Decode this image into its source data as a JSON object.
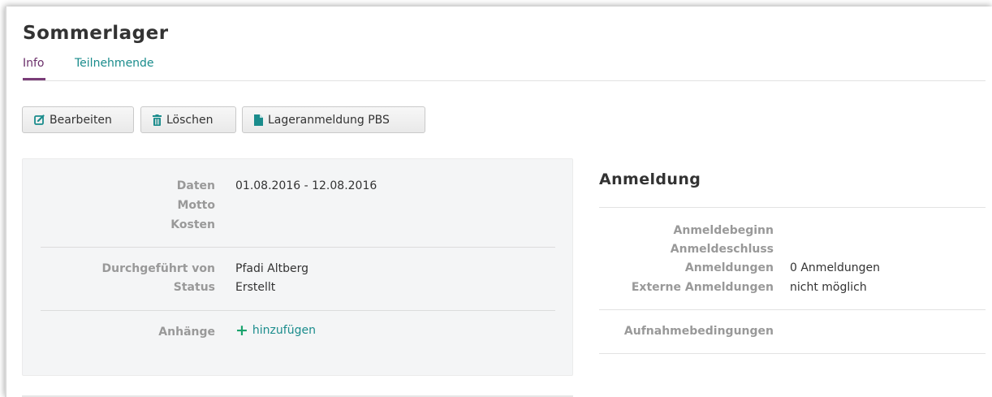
{
  "page": {
    "title": "Sommerlager"
  },
  "tabs": [
    {
      "label": "Info",
      "active": true
    },
    {
      "label": "Teilnehmende",
      "active": false
    }
  ],
  "toolbar": {
    "edit_label": "Bearbeiten",
    "delete_label": "Löschen",
    "pbs_label": "Lageranmeldung PBS",
    "edit_icon": "edit-icon",
    "delete_icon": "trash-icon",
    "pbs_icon": "file-icon"
  },
  "details": {
    "daten_label": "Daten",
    "daten_value": "01.08.2016 - 12.08.2016",
    "motto_label": "Motto",
    "kosten_label": "Kosten",
    "durchgefuehrt_label": "Durchgeführt von",
    "durchgefuehrt_value": "Pfadi Altberg",
    "status_label": "Status",
    "status_value": "Erstellt",
    "anhaenge_label": "Anhänge",
    "anhaenge_add": "hinzufügen"
  },
  "registration": {
    "title": "Anmeldung",
    "beginn_label": "Anmeldebeginn",
    "schluss_label": "Anmeldeschluss",
    "count_label": "Anmeldungen",
    "count_value": "0 Anmeldungen",
    "external_label": "Externe Anmeldungen",
    "external_value": "nicht möglich",
    "conditions_label": "Aufnahmebedingungen"
  },
  "colors": {
    "accent_purple": "#7a3d78",
    "link_teal": "#1a8c8c",
    "plus_green": "#1aa36d"
  }
}
